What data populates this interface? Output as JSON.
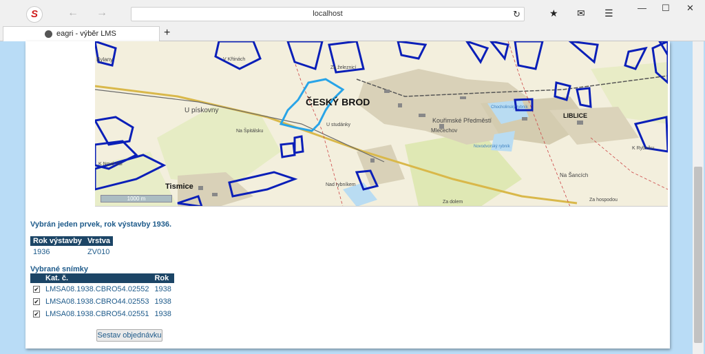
{
  "browser": {
    "url": "localhost",
    "tab_title": "eagri - výběr LMS",
    "new_tab": "+"
  },
  "map": {
    "labels": {
      "town": "ČESKÝ BROD",
      "tismice": "Tismice",
      "liblice": "LIBLICE",
      "kourimske": "Kouřimské Předměstí",
      "mlecechov": "Mlecechov",
      "na_sancich": "Na Šancích",
      "u_piskovny": "U pískovny",
      "na_spitalsku": "Na Špitálsku",
      "za_zeleznici": "Za železnicí",
      "k_nove_vsi": "K Nové Vsi",
      "k_rybniku": "K Rybníku",
      "cholunsky": "Chocholinský rybník",
      "novodvorsky": "Novodvorský rybník",
      "za_hospodou": "Za hospodou",
      "nad_ryb": "Nad rybníkem",
      "za_dolem": "Za dolem",
      "v_kritinach": "V Křtinách",
      "u_studanky": "U studánky",
      "bylany": "Bylany"
    },
    "scale_text": "1000 m",
    "colors": {
      "polygon": "#0a1fb8",
      "selected": "#28a4e8",
      "town": "#c8c0a8",
      "forest": "#d8e8a8"
    }
  },
  "selection": {
    "summary": "Vybrán jeden prvek, rok výstavby 1936.",
    "headers": [
      "Rok výstavby",
      "Vrstva"
    ],
    "rows": [
      [
        "1936",
        "ZV010"
      ]
    ]
  },
  "snapshots": {
    "title": "Vybrané snímky",
    "headers": [
      "",
      "Kat. č.",
      "Rok"
    ],
    "rows": [
      {
        "checked": true,
        "kat": "LMSA08.1938.CBRO54.02552",
        "rok": "1938"
      },
      {
        "checked": true,
        "kat": "LMSA08.1938.CBRO44.02553",
        "rok": "1938"
      },
      {
        "checked": true,
        "kat": "LMSA08.1938.CBRO54.02551",
        "rok": "1938"
      }
    ]
  },
  "order_button": "Sestav objednávku"
}
